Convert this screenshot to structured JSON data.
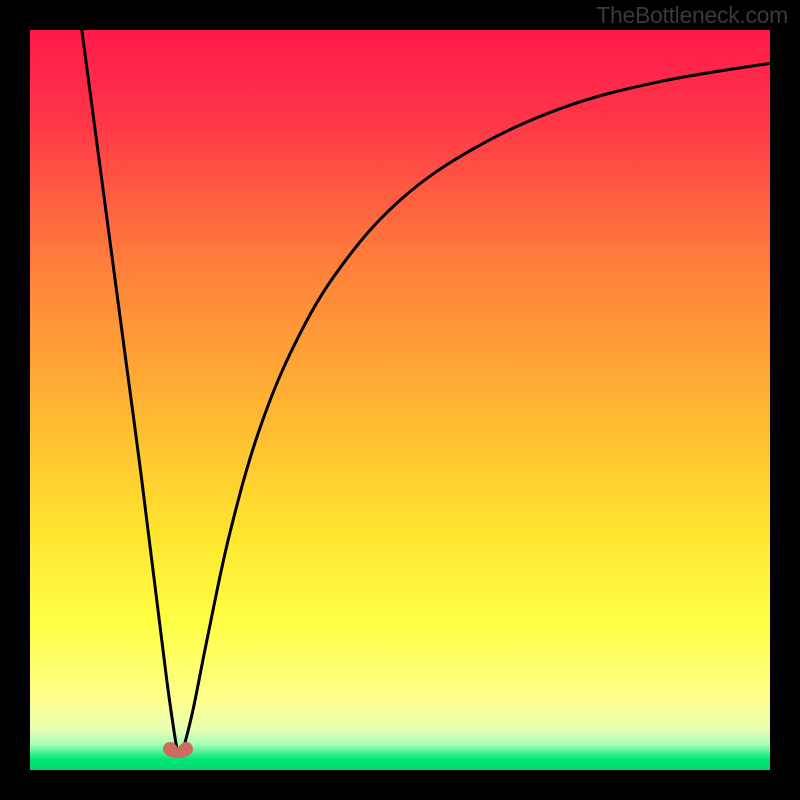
{
  "watermark": "TheBottleneck.com",
  "chart_data": {
    "type": "line",
    "title": "",
    "xlabel": "",
    "ylabel": "",
    "xlim": [
      0,
      100
    ],
    "ylim": [
      0,
      100
    ],
    "gradient_stops": [
      {
        "offset": 0.0,
        "color": "#ff1a4b"
      },
      {
        "offset": 0.12,
        "color": "#ff3548"
      },
      {
        "offset": 0.3,
        "color": "#ff7a3c"
      },
      {
        "offset": 0.5,
        "color": "#ffb233"
      },
      {
        "offset": 0.68,
        "color": "#ffe52e"
      },
      {
        "offset": 0.8,
        "color": "#ffff44"
      },
      {
        "offset": 0.9,
        "color": "#ffff88"
      },
      {
        "offset": 0.945,
        "color": "#e8ffb0"
      },
      {
        "offset": 0.965,
        "color": "#a8ffb8"
      },
      {
        "offset": 0.985,
        "color": "#00e878"
      },
      {
        "offset": 1.0,
        "color": "#00d870"
      }
    ],
    "series": [
      {
        "name": "left-descending",
        "points": [
          {
            "x": 7.0,
            "y": 100.0
          },
          {
            "x": 9.0,
            "y": 85.0
          },
          {
            "x": 11.0,
            "y": 70.0
          },
          {
            "x": 13.0,
            "y": 55.0
          },
          {
            "x": 15.0,
            "y": 40.0
          },
          {
            "x": 17.0,
            "y": 24.0
          },
          {
            "x": 18.5,
            "y": 12.0
          },
          {
            "x": 19.5,
            "y": 5.0
          },
          {
            "x": 20.0,
            "y": 2.0
          }
        ]
      },
      {
        "name": "right-ascending",
        "points": [
          {
            "x": 20.5,
            "y": 2.0
          },
          {
            "x": 22.0,
            "y": 8.0
          },
          {
            "x": 24.0,
            "y": 18.0
          },
          {
            "x": 27.0,
            "y": 32.0
          },
          {
            "x": 31.0,
            "y": 46.0
          },
          {
            "x": 36.0,
            "y": 58.0
          },
          {
            "x": 42.0,
            "y": 68.0
          },
          {
            "x": 50.0,
            "y": 77.0
          },
          {
            "x": 60.0,
            "y": 84.0
          },
          {
            "x": 72.0,
            "y": 89.5
          },
          {
            "x": 85.0,
            "y": 93.0
          },
          {
            "x": 100.0,
            "y": 95.5
          }
        ]
      }
    ],
    "marker": {
      "x": 20.0,
      "y": 2.5,
      "color": "#cc6b5e"
    }
  }
}
